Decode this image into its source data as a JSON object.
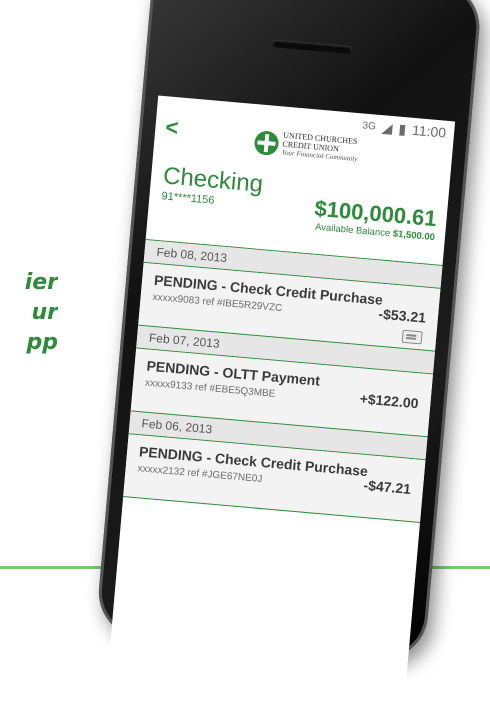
{
  "tagline": [
    "ier",
    "ur",
    "pp"
  ],
  "status_bar": {
    "network": "3G",
    "time": "11:00"
  },
  "header": {
    "back": "<",
    "logo_line1": "UNITED CHURCHES",
    "logo_line2": "CREDIT UNION",
    "logo_tag": "Your Financial Community"
  },
  "account": {
    "name": "Checking",
    "number": "91****1156",
    "balance": "$100,000.61",
    "available_label": "Available Balance",
    "available_value": "$1,500.00"
  },
  "transactions": [
    {
      "date": "Feb 08, 2013",
      "title": "PENDING - Check Credit Purchase",
      "ref": "xxxxx9083 ref #IBE5R29VZC",
      "amount": "-$53.21"
    },
    {
      "date": "Feb 07, 2013",
      "title": "PENDING - OLTT Payment",
      "ref": "xxxxx9133 ref #EBE5Q3MBE",
      "amount": "+$122.00"
    },
    {
      "date": "Feb 06, 2013",
      "title": "PENDING - Check Credit Purchase",
      "ref": "xxxxx2132 ref #JGE67NE0J",
      "amount": "-$47.21"
    }
  ]
}
